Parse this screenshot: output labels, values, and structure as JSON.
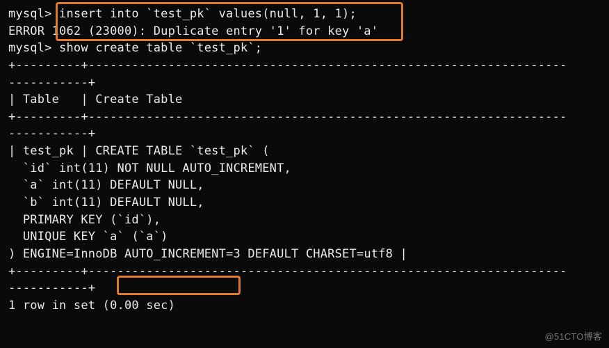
{
  "prompt": "mysql> ",
  "cmd_insert": "insert into `test_pk` values(null, 1, 1);",
  "error_line": "ERROR 1062 (23000): Duplicate entry '1' for key 'a'",
  "cmd_show": "show create table `test_pk`;",
  "sep_top1": "+---------+------------------------------------------------------------------",
  "sep_top2": "-----------+",
  "header_line": "| Table   | Create Table                                                     ",
  "body_open": "| test_pk | CREATE TABLE `test_pk` (",
  "col_id": "  `id` int(11) NOT NULL AUTO_INCREMENT,",
  "col_a": "  `a` int(11) DEFAULT NULL,",
  "col_b": "  `b` int(11) DEFAULT NULL,",
  "pk_line": "  PRIMARY KEY (`id`),",
  "uk_line": "  UNIQUE KEY `a` (`a`)",
  "engine_pre": ") ENGINE=InnoDB ",
  "engine_auto": "AUTO_INCREMENT=3",
  "engine_post": " DEFAULT CHARSET=utf8 |",
  "result_line": "1 row in set (0.00 sec)",
  "watermark": "@51CTO博客",
  "chart_data": {
    "type": "table",
    "title": "SHOW CREATE TABLE `test_pk`",
    "columns": [
      "Table",
      "Create Table"
    ],
    "rows": [
      {
        "Table": "test_pk",
        "Create Table": "CREATE TABLE `test_pk` (\n  `id` int(11) NOT NULL AUTO_INCREMENT,\n  `a` int(11) DEFAULT NULL,\n  `b` int(11) DEFAULT NULL,\n  PRIMARY KEY (`id`),\n  UNIQUE KEY `a` (`a`)\n) ENGINE=InnoDB AUTO_INCREMENT=3 DEFAULT CHARSET=utf8"
      }
    ],
    "result_summary": "1 row in set (0.00 sec)",
    "error": {
      "code": 1062,
      "sqlstate": "23000",
      "message": "Duplicate entry '1' for key 'a'"
    }
  }
}
